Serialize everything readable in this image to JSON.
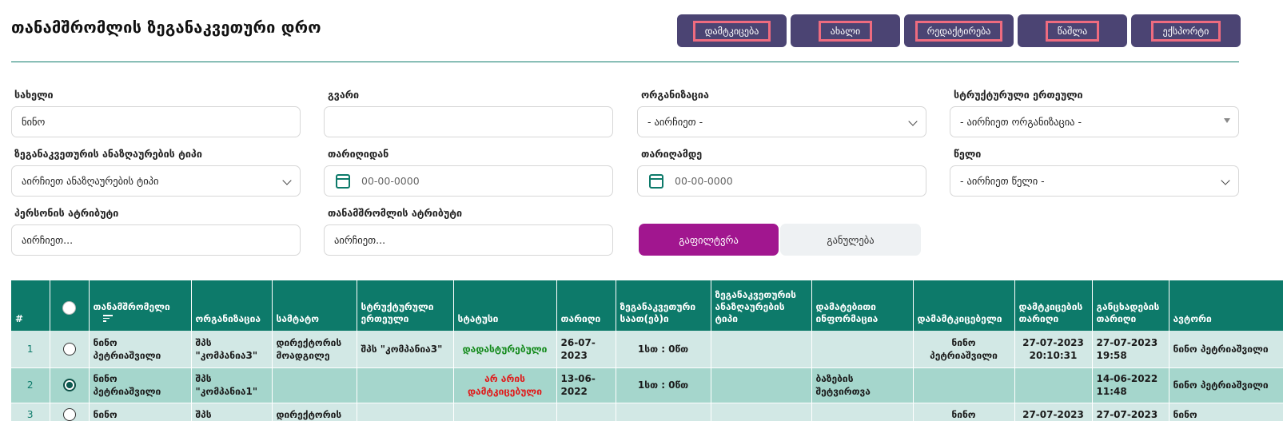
{
  "header": {
    "title": "თანამშრომლის ზეგანაკვეთური დრო",
    "buttons": [
      "დამტკიცება",
      "ახალი",
      "რედაქტირება",
      "წაშლა",
      "ექსპორტი"
    ]
  },
  "filters": {
    "name_label": "სახელი",
    "name_value": "ნინო",
    "surname_label": "გვარი",
    "surname_value": "",
    "org_label": "ორგანიზაცია",
    "org_value": "- აირჩიეთ -",
    "unit_label": "სტრუქტურული ერთეული",
    "unit_value": "- აირჩიეთ ორგანიზაცია -",
    "comp_type_label": "ზეგანაკვეთურის ანაზღაურების ტიპი",
    "comp_type_value": "აირჩიეთ ანაზღაურების ტიპი",
    "date_from_label": "თარიღიდან",
    "date_from_placeholder": "00-00-0000",
    "date_to_label": "თარიღამდე",
    "date_to_placeholder": "00-00-0000",
    "year_label": "წელი",
    "year_value": "- აირჩიეთ წელი -",
    "person_attr_label": "პერსონის ატრიბუტი",
    "person_attr_value": "აირჩიეთ...",
    "emp_attr_label": "თანამშრომლის ატრიბუტი",
    "emp_attr_value": "აირჩიეთ...",
    "filter_button": "გაფილტვრა",
    "clear_button": "განულება"
  },
  "table": {
    "columns": [
      "#",
      "",
      "თანამშრომელი",
      "ორგანიზაცია",
      "სამტატო",
      "სტრუქტურული ერთეული",
      "სტატუსი",
      "თარიღი",
      "ზეგანაკვეთური საათ(ებ)ი",
      "ზეგანაკვეთურის ანაზღაურების ტიპი",
      "დამატებითი ინფორმაცია",
      "დამამტკიცებელი",
      "დამტკიცების თარიღი",
      "განცხადების თარიღი",
      "ავტორი"
    ],
    "rows": [
      {
        "num": "1",
        "employee": "ნინო პეტრიაშვილი",
        "org": "შპს \"კომპანია3\"",
        "position": "დირექტორის მოადგილე",
        "unit": "შპს \"კომპანია3\"",
        "status": "დადასტურებული",
        "date": "26-07-2023",
        "hours": "1სთ : 0წთ",
        "comp_type": "",
        "info": "",
        "approver": "ნინო პეტრიაშვილი",
        "approve_date": "27-07-2023 20:10:31",
        "request_date": "27-07-2023 19:58",
        "author": "ნინო პეტრიაშვილი"
      },
      {
        "num": "2",
        "employee": "ნინო პეტრიაშვილი",
        "org": "შპს \"კომპანია1\"",
        "position": "",
        "unit": "",
        "status": "არ არის დამტკიცებული",
        "date": "13-06-2022",
        "hours": "1სთ : 0წთ",
        "comp_type": "",
        "info": "ბაზების შეტვირთვა",
        "approver": "",
        "approve_date": "",
        "request_date": "14-06-2022 11:48",
        "author": "ნინო პეტრიაშვილი"
      },
      {
        "num": "3",
        "employee": "ნინო",
        "org": "შპს",
        "position": "დირექტორის",
        "unit": "",
        "status": "",
        "date": "",
        "hours": "",
        "comp_type": "",
        "info": "",
        "approver": "ნინო",
        "approve_date": "27-07-2023",
        "request_date": "27-07-2023",
        "author": "ნინო"
      }
    ]
  },
  "colors": {
    "primary": "#0d7a6a",
    "toolbar_button": "#4b4473",
    "filter_button": "#a1168f",
    "status_ok": "#138a1b",
    "status_bad": "#e01a1a"
  }
}
